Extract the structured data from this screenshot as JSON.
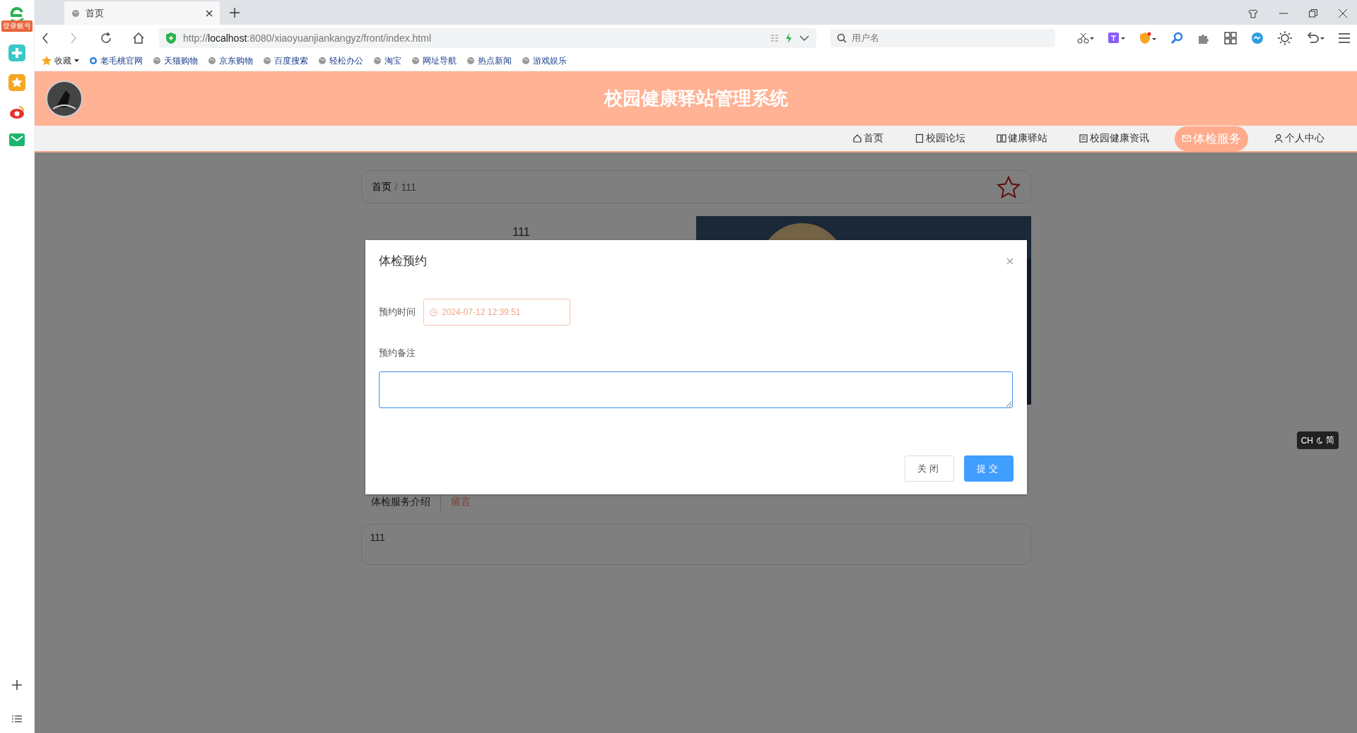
{
  "browser": {
    "tab": {
      "title": "首页"
    },
    "address": {
      "url": "http://**localhost**:8080/xiaoyuanjiankangyz/front/index.html"
    },
    "search": {
      "placeholder": "用户名"
    },
    "bookmarks": [
      {
        "label": "收藏",
        "kind": "star"
      },
      {
        "label": "老毛桃官网",
        "kind": "site"
      },
      {
        "label": "天猫购物",
        "kind": "globe"
      },
      {
        "label": "京东购物",
        "kind": "globe"
      },
      {
        "label": "百度搜索",
        "kind": "globe"
      },
      {
        "label": "轻松办公",
        "kind": "globe"
      },
      {
        "label": "淘宝",
        "kind": "globe"
      },
      {
        "label": "网址导航",
        "kind": "globe"
      },
      {
        "label": "热点新闻",
        "kind": "globe"
      },
      {
        "label": "游戏娱乐",
        "kind": "globe"
      }
    ]
  },
  "sidebar": {
    "badge": "登录账号"
  },
  "site": {
    "title": "校园健康驿站管理系统",
    "nav": [
      {
        "label": "首页",
        "selected": false
      },
      {
        "label": "校园论坛",
        "selected": false
      },
      {
        "label": "健康驿站",
        "selected": false
      },
      {
        "label": "校园健康资讯",
        "selected": false
      },
      {
        "label": "体检服务",
        "selected": true
      },
      {
        "label": "个人中心",
        "selected": false
      }
    ]
  },
  "breadcrumb": {
    "items": [
      "首页",
      "111"
    ],
    "separator": "/"
  },
  "detail": {
    "title": "111",
    "tabs": [
      {
        "label": "体检服务介绍",
        "selected": true
      },
      {
        "label": "留言",
        "selected": false
      }
    ],
    "content": "111"
  },
  "dialog": {
    "title": "体检预约",
    "fields": [
      {
        "label": "预约时间",
        "kind": "datetime",
        "value": "2024-07-12 12:39:51"
      },
      {
        "label": "预约备注",
        "kind": "textarea"
      }
    ],
    "buttons": [
      {
        "label": "关闭",
        "kind": "default"
      },
      {
        "label": "提交",
        "kind": "primary"
      }
    ]
  },
  "ime": {
    "left": "CH",
    "right": "简"
  }
}
